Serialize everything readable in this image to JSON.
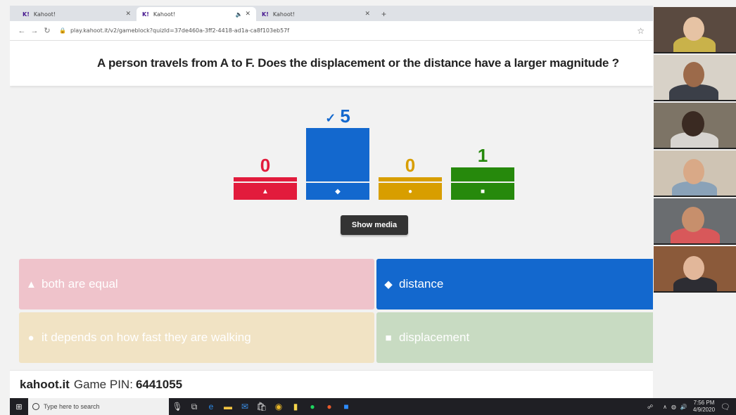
{
  "browser": {
    "tabs": [
      {
        "label": "Kahoot!",
        "logo": "K!"
      },
      {
        "label": "Kahoot!",
        "logo": "K!"
      },
      {
        "label": "Kahoot!",
        "logo": "K!"
      }
    ],
    "url": "play.kahoot.it/v2/gameblock?quizId=37de460a-3ff2-4418-ad1a-ca8f103eb57f"
  },
  "question": "A person travels from A to F. Does the displacement or the distance have a larger magnitude ?",
  "results": {
    "bars": [
      {
        "count": "0",
        "value": 0,
        "shape": "triangle-icon",
        "glyph": "▲",
        "color": "#e21b3c",
        "correct": false
      },
      {
        "count": "5",
        "value": 5,
        "shape": "diamond-icon",
        "glyph": "◆",
        "color": "#1368ce",
        "correct": true,
        "check": "✓"
      },
      {
        "count": "0",
        "value": 0,
        "shape": "circle-icon",
        "glyph": "●",
        "color": "#d89e00",
        "correct": false
      },
      {
        "count": "1",
        "value": 1,
        "shape": "square-icon",
        "glyph": "■",
        "color": "#26890c",
        "correct": false
      }
    ],
    "max": 5
  },
  "show_media_label": "Show media",
  "answers": [
    {
      "text": "both are equal",
      "glyph": "▲",
      "shape": "triangle-icon",
      "color": "#efc3cb"
    },
    {
      "text": "distance",
      "glyph": "◆",
      "shape": "diamond-icon",
      "color": "#1368ce"
    },
    {
      "text": "it depends on how fast they are walking",
      "glyph": "●",
      "shape": "circle-icon",
      "color": "#f1e3c4"
    },
    {
      "text": "displacement",
      "glyph": "■",
      "shape": "square-icon",
      "color": "#c8dbc2"
    }
  ],
  "footer": {
    "brand": "kahoot.it",
    "pin_label": "Game PIN:",
    "pin": "6441055"
  },
  "taskbar": {
    "search_placeholder": "Type here to search",
    "time": "7:56 PM",
    "date": "4/9/2020"
  },
  "colors": {
    "text": "#222222",
    "footer_bg": "#ffffff",
    "taskbar_bg": "#1f1f24"
  }
}
